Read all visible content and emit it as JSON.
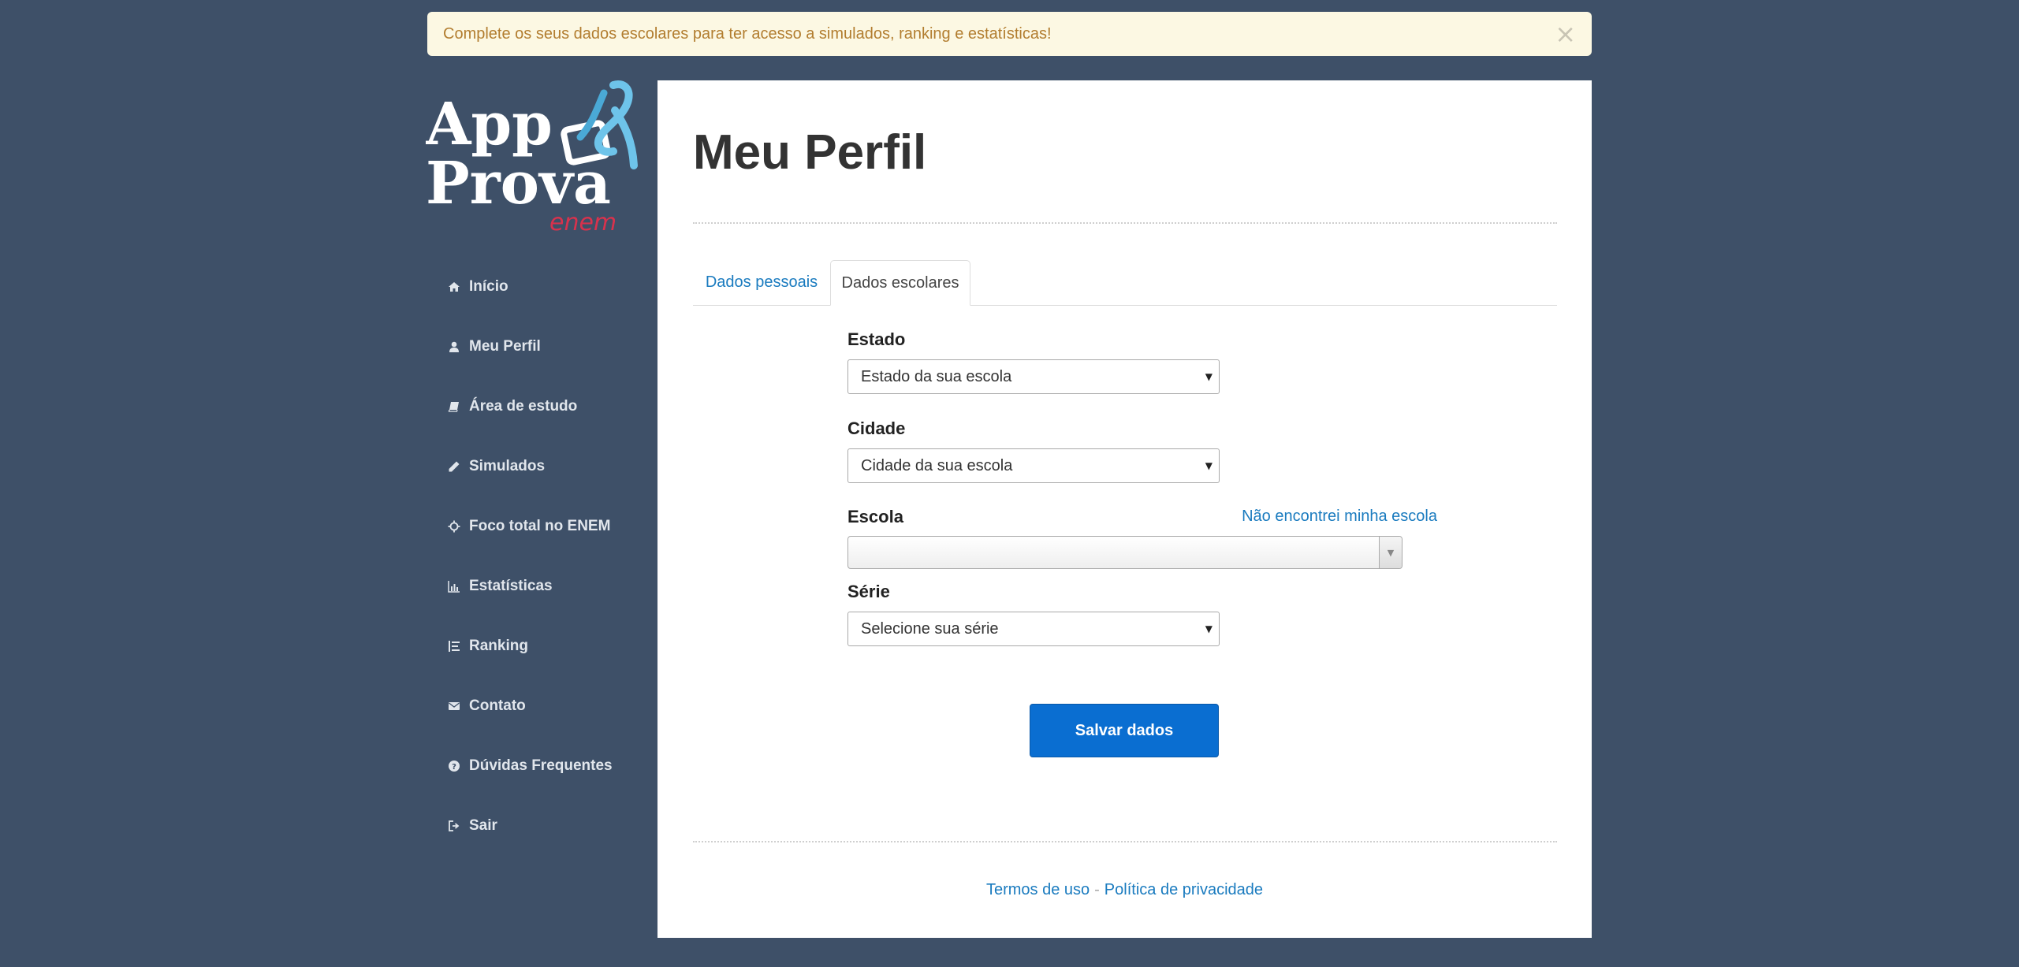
{
  "alert": {
    "message": "Complete os seus dados escolares para ter acesso a simulados, ranking e estatísticas!",
    "close_glyph": "×"
  },
  "logo": {
    "line1": "App",
    "line2": "Prova",
    "tagline": "enem",
    "ribbon_color": "#6ec4ea",
    "tagline_color": "#d8324d"
  },
  "nav": {
    "items": [
      {
        "label": "Início",
        "icon": "home-icon"
      },
      {
        "label": "Meu Perfil",
        "icon": "user-icon"
      },
      {
        "label": "Área de estudo",
        "icon": "book-icon"
      },
      {
        "label": "Simulados",
        "icon": "pencil-icon"
      },
      {
        "label": "Foco total no ENEM",
        "icon": "crosshairs-icon"
      },
      {
        "label": "Estatísticas",
        "icon": "bar-chart-icon"
      },
      {
        "label": "Ranking",
        "icon": "list-ordered-icon"
      },
      {
        "label": "Contato",
        "icon": "envelope-icon"
      },
      {
        "label": "Dúvidas Frequentes",
        "icon": "question-circle-icon"
      },
      {
        "label": "Sair",
        "icon": "sign-out-icon"
      }
    ]
  },
  "main": {
    "title": "Meu Perfil",
    "tabs": [
      {
        "label": "Dados pessoais",
        "active": false
      },
      {
        "label": "Dados escolares",
        "active": true
      }
    ],
    "form": {
      "estado": {
        "label": "Estado",
        "value": "Estado da sua escola"
      },
      "cidade": {
        "label": "Cidade",
        "value": "Cidade da sua escola"
      },
      "escola": {
        "label": "Escola",
        "value": "",
        "not_found_link": "Não encontrei minha escola"
      },
      "serie": {
        "label": "Série",
        "value": "Selecione sua série"
      },
      "submit_label": "Salvar dados"
    }
  },
  "footer": {
    "terms": "Termos de uso",
    "separator": "-",
    "privacy": "Política de privacidade"
  },
  "colors": {
    "background": "#3e5068",
    "accent": "#0a6ed1",
    "link": "#1a7bbf",
    "alert_bg": "#fcf8e3",
    "alert_text": "#b27d2f"
  }
}
